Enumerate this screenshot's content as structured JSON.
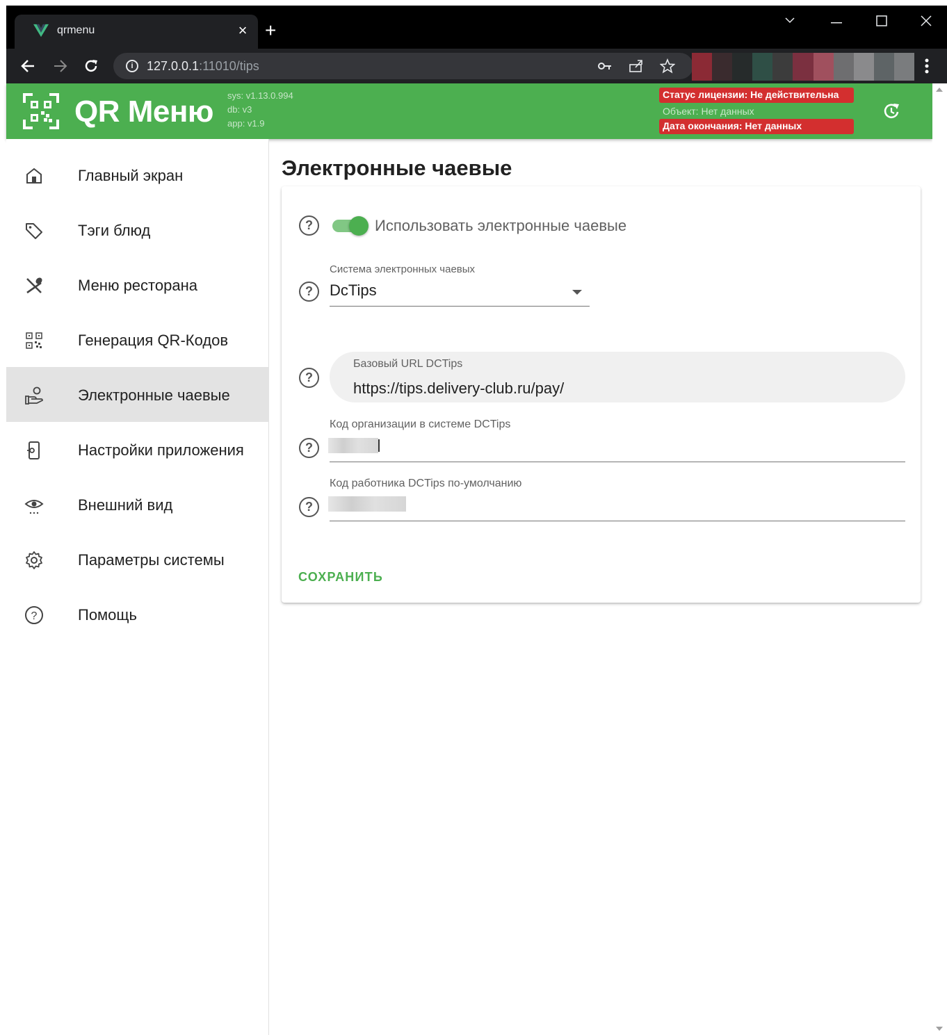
{
  "browser": {
    "tab_title": "qrmenu",
    "url_host": "127.0.0.1",
    "url_rest": ":11010/tips",
    "new_tab": "+",
    "tab_close": "×"
  },
  "app": {
    "brand": "QR Меню",
    "versions": {
      "sys": "sys: v1.13.0.994",
      "db": "db: v3",
      "app": "app: v1.9"
    },
    "license": {
      "status": "Статус лицензии: Не действительна",
      "object": "Объект: Нет данных",
      "expiry": "Дата окончания: Нет данных"
    },
    "colors": {
      "primary": "#4caf50",
      "danger": "#d32f2f"
    }
  },
  "sidebar": {
    "items": [
      {
        "label": "Главный экран",
        "icon": "home-icon"
      },
      {
        "label": "Тэги блюд",
        "icon": "tag-icon"
      },
      {
        "label": "Меню ресторана",
        "icon": "utensils-icon"
      },
      {
        "label": "Генерация QR-Кодов",
        "icon": "qr-code-icon"
      },
      {
        "label": "Электронные чаевые",
        "icon": "tip-hand-icon",
        "active": true
      },
      {
        "label": "Настройки приложения",
        "icon": "phone-settings-icon"
      },
      {
        "label": "Внешний вид",
        "icon": "eye-icon"
      },
      {
        "label": "Параметры системы",
        "icon": "gear-icon"
      },
      {
        "label": "Помощь",
        "icon": "help-icon"
      }
    ]
  },
  "main": {
    "title": "Электронные чаевые",
    "switch_label": "Использовать электронные чаевые",
    "switch_on": true,
    "system_label": "Система электронных чаевых",
    "system_value": "DcTips",
    "base_url_label": "Базовый URL DCTips",
    "base_url_value": "https://tips.delivery-club.ru/pay/",
    "org_code_label": "Код организации в системе DCTips",
    "worker_code_label": "Код работника DCTips по-умолчанию",
    "save_label": "СОХРАНИТЬ",
    "help_glyph": "?"
  }
}
